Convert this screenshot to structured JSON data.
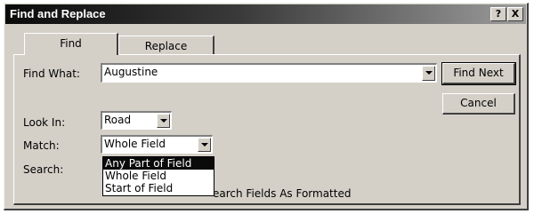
{
  "window": {
    "title": "Find and Replace",
    "help_label": "?",
    "close_label": "X"
  },
  "tabs": [
    {
      "label": "Find",
      "active": true
    },
    {
      "label": "Replace",
      "active": false
    }
  ],
  "find_what": {
    "label": "Find What:",
    "value": "Augustine"
  },
  "look_in": {
    "label": "Look In:",
    "value": "Road"
  },
  "match": {
    "label": "Match:",
    "value": "Whole Field",
    "options": [
      "Any Part of Field",
      "Whole Field",
      "Start of Field"
    ],
    "highlighted_option": "Any Part of Field"
  },
  "search": {
    "label": "Search:"
  },
  "search_fields_formatted": {
    "visible_label": "earch Fields As Formatted"
  },
  "buttons": {
    "find_next": "Find Next",
    "cancel": "Cancel"
  }
}
